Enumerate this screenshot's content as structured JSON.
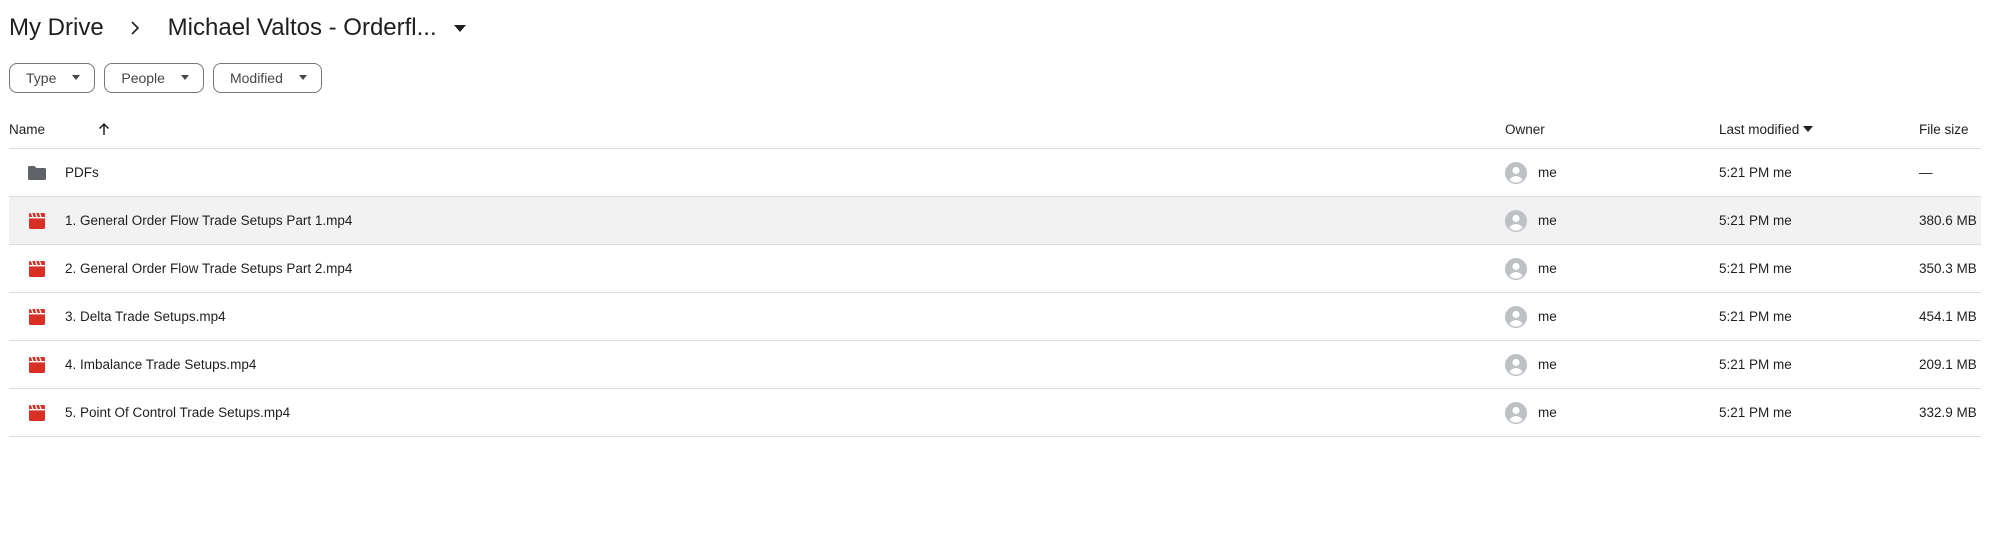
{
  "breadcrumb": {
    "root": "My Drive",
    "current": "Michael Valtos - Orderfl..."
  },
  "filters": [
    {
      "label": "Type"
    },
    {
      "label": "People"
    },
    {
      "label": "Modified"
    }
  ],
  "table": {
    "headers": {
      "name": "Name",
      "owner": "Owner",
      "modified": "Last modified",
      "size": "File size"
    },
    "rows": [
      {
        "icon": "folder-icon",
        "name": "PDFs",
        "owner": "me",
        "modified": "5:21 PM me",
        "size": "—",
        "selected": false
      },
      {
        "icon": "video-file-icon",
        "name": "1. General Order Flow Trade Setups Part 1.mp4",
        "owner": "me",
        "modified": "5:21 PM me",
        "size": "380.6 MB",
        "selected": true
      },
      {
        "icon": "video-file-icon",
        "name": "2. General Order Flow Trade Setups Part 2.mp4",
        "owner": "me",
        "modified": "5:21 PM me",
        "size": "350.3 MB",
        "selected": false
      },
      {
        "icon": "video-file-icon",
        "name": "3. Delta Trade Setups.mp4",
        "owner": "me",
        "modified": "5:21 PM me",
        "size": "454.1 MB",
        "selected": false
      },
      {
        "icon": "video-file-icon",
        "name": "4. Imbalance Trade Setups.mp4",
        "owner": "me",
        "modified": "5:21 PM me",
        "size": "209.1 MB",
        "selected": false
      },
      {
        "icon": "video-file-icon",
        "name": "5. Point Of Control Trade Setups.mp4",
        "owner": "me",
        "modified": "5:21 PM me",
        "size": "332.9 MB",
        "selected": false
      }
    ]
  },
  "colors": {
    "video_icon": "#d93025",
    "folder_icon": "#5f6368",
    "avatar": "#bdc1c6",
    "selected_row": "#f2f2f2",
    "divider": "#dadce0"
  }
}
